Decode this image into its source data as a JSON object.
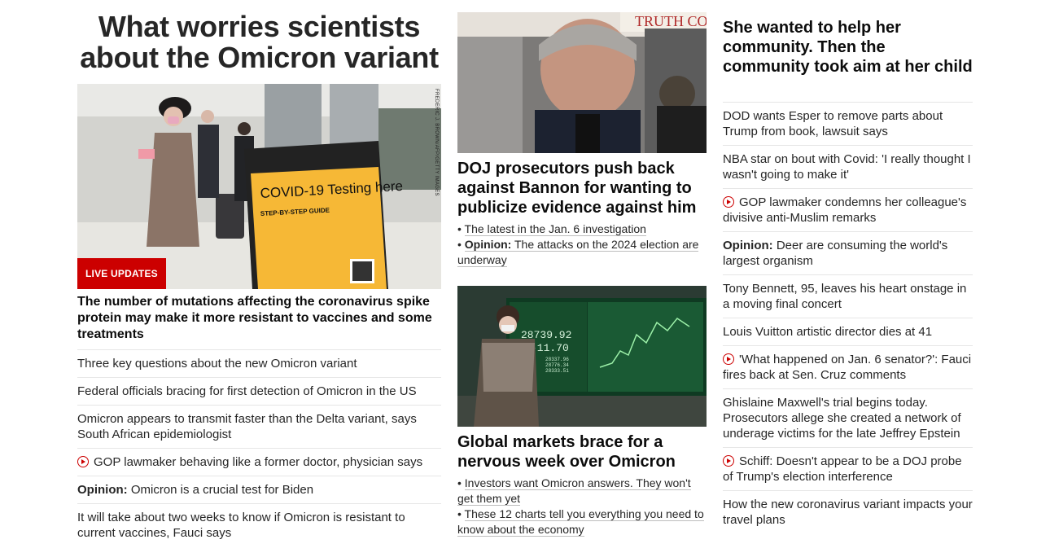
{
  "col1": {
    "title": "What worries scientists about the Omicron variant",
    "hero_image": {
      "alt": "Travelers walking past a COVID-19 Testing here sign at an airport",
      "sign_text": "COVID-19 Testing here",
      "sign_sub": "STEP-BY-STEP GUIDE",
      "credit": "FREDERIC J. BROWN/AFP/GETTY IMAGES"
    },
    "badge": "LIVE UPDATES",
    "headline": "The number of mutations affecting the coronavirus spike protein may make it more resistant to vaccines and some treatments",
    "items": [
      {
        "text": "Three key questions about the new Omicron variant"
      },
      {
        "text": "Federal officials bracing for first detection of Omicron in the US"
      },
      {
        "text": "Omicron appears to transmit faster than the Delta variant, says South African epidemiologist"
      },
      {
        "text": "GOP lawmaker behaving like a former doctor, physician says",
        "video": true
      },
      {
        "prefix": "Opinion:",
        "text": "Omicron is a crucial test for Biden"
      },
      {
        "text": "It will take about two weeks to know if Omicron is resistant to current vaccines, Fauci says"
      }
    ]
  },
  "col2": {
    "story1": {
      "image_alt": "Steve Bannon outside courthouse",
      "sign_text": "TRUTH CO",
      "headline": "DOJ prosecutors push back against Bannon for wanting to publicize evidence against him",
      "bullets": [
        {
          "text": "The latest in the Jan. 6 investigation"
        },
        {
          "prefix": "Opinion:",
          "text": "The attacks on the 2024 election are underway"
        }
      ]
    },
    "story2": {
      "image_alt": "Woman walking past stock market board",
      "board_value": "28739.92",
      "board_change": "-11.70",
      "board_small1": "28337.96",
      "board_small2": "28776.34",
      "board_small3": "28333.51",
      "headline": "Global markets brace for a nervous week over Omicron",
      "bullets": [
        {
          "text": "Investors want Omicron answers. They won't get them yet"
        },
        {
          "text": "These 12 charts tell you everything you need to know about the economy"
        }
      ]
    }
  },
  "col3": {
    "headline": "She wanted to help her community. Then the community took aim at her child",
    "items": [
      {
        "text": "DOD wants Esper to remove parts about Trump from book, lawsuit says"
      },
      {
        "text": "NBA star on bout with Covid: 'I really thought I wasn't going to make it'"
      },
      {
        "text": "GOP lawmaker condemns her colleague's divisive anti-Muslim remarks",
        "video": true
      },
      {
        "prefix": "Opinion:",
        "text": "Deer are consuming the world's largest organism"
      },
      {
        "text": "Tony Bennett, 95, leaves his heart onstage in a moving final concert"
      },
      {
        "text": "Louis Vuitton artistic director dies at 41"
      },
      {
        "text": "'What happened on Jan. 6 senator?': Fauci fires back at Sen. Cruz comments",
        "video": true
      },
      {
        "text": "Ghislaine Maxwell's trial begins today. Prosecutors allege she created a network of underage victims for the late Jeffrey Epstein"
      },
      {
        "text": "Schiff: Doesn't appear to be a DOJ probe of Trump's election interference",
        "video": true
      },
      {
        "text": "How the new coronavirus variant impacts your travel plans"
      }
    ]
  },
  "colors": {
    "accent_red": "#cc0000",
    "text": "#262626",
    "divider": "#e6e6e6"
  }
}
